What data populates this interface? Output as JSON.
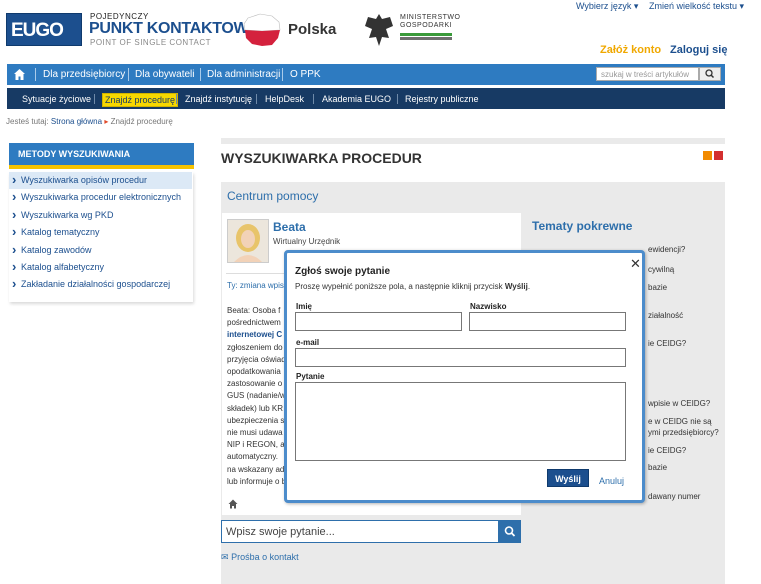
{
  "header": {
    "logo": "EUGO",
    "pk_small": "POJEDYNCZY",
    "pk_big": "PUNKT KONTAKTOWY",
    "pk_sub": "POINT OF SINGLE CONTACT",
    "country": "Polska",
    "ministry_line1": "MINISTERSTWO",
    "ministry_line2": "GOSPODARKI",
    "lang_link": "Wybierz język ▾",
    "size_link": "Zmień wielkość tekstu ▾",
    "register": "Załóż konto",
    "login": "Zaloguj się"
  },
  "nav_main": {
    "items": [
      "Dla przedsiębiorcy",
      "Dla obywateli",
      "Dla administracji",
      "O PPK"
    ],
    "search_placeholder": "szukaj w treści artykułów"
  },
  "nav_sub": {
    "items": [
      "Sytuacje życiowe",
      "Znajdź procedurę",
      "Znajdź instytucję",
      "HelpDesk",
      "Akademia EUGO",
      "Rejestry publiczne"
    ],
    "active_index": 1
  },
  "breadcrumb": {
    "prefix": "Jesteś tutaj:",
    "home": "Strona główna",
    "current": "Znajdź procedurę"
  },
  "left_menu": {
    "title": "METODY WYSZUKIWANIA",
    "items": [
      "Wyszukiwarka opisów procedur",
      "Wyszukiwarka procedur elektronicznych",
      "Wyszukiwarka wg PKD",
      "Katalog tematyczny",
      "Katalog zawodów",
      "Katalog alfabetyczny",
      "Zakładanie działalności gospodarczej"
    ],
    "selected_index": 0
  },
  "main": {
    "title": "WYSZUKIWARKA PROCEDUR",
    "help_center": "Centrum pomocy",
    "agent_name": "Beata",
    "agent_role": "Wirtualny Urzędnik",
    "ty_label": "Ty: zmiana wpisu",
    "body_lines": [
      "Beata: Osoba f",
      "pośrednictwem",
      "internetowej C",
      "zgłoszeniem do",
      "przyjęcia oświad",
      "opodatkowania",
      "zastosowanie o",
      "GUS (nadanie/w",
      "składek) lub KR",
      "ubezpieczenia s",
      "nie musi udawa",
      "NIP i REGON, a",
      "automatyczny.",
      "na wskazany ad",
      "lub informuje o b"
    ],
    "ask_placeholder": "Wpisz swoje pytanie...",
    "contact_link": "Prośba o kontakt",
    "related_title": "Tematy pokrewne",
    "related_items": [
      "ewidencji?",
      "cywilną",
      "bazie",
      "ziałalność",
      "ie CEIDG?",
      "wpisie w CEIDG?",
      "e w CEIDG nie są",
      "ymi przedsiębiorcy?",
      "ie CEIDG?",
      "bazie",
      "dawany numer"
    ]
  },
  "modal": {
    "title": "Zgłoś swoje pytanie",
    "desc_before": "Proszę wypełnić poniższe pola, a następnie kliknij przycisk ",
    "desc_bold": "Wyślij",
    "desc_after": ".",
    "label_first_name": "Imię",
    "label_last_name": "Nazwisko",
    "label_email": "e-mail",
    "label_question": "Pytanie",
    "send": "Wyślij",
    "cancel": "Anuluj",
    "close": "✕"
  },
  "colors": {
    "nav_blue": "#2e7bc1",
    "nav_dark": "#173a64",
    "accent_yellow": "#f7d800",
    "link_blue": "#1c4f8e",
    "modal_border": "#4c8ccb"
  }
}
